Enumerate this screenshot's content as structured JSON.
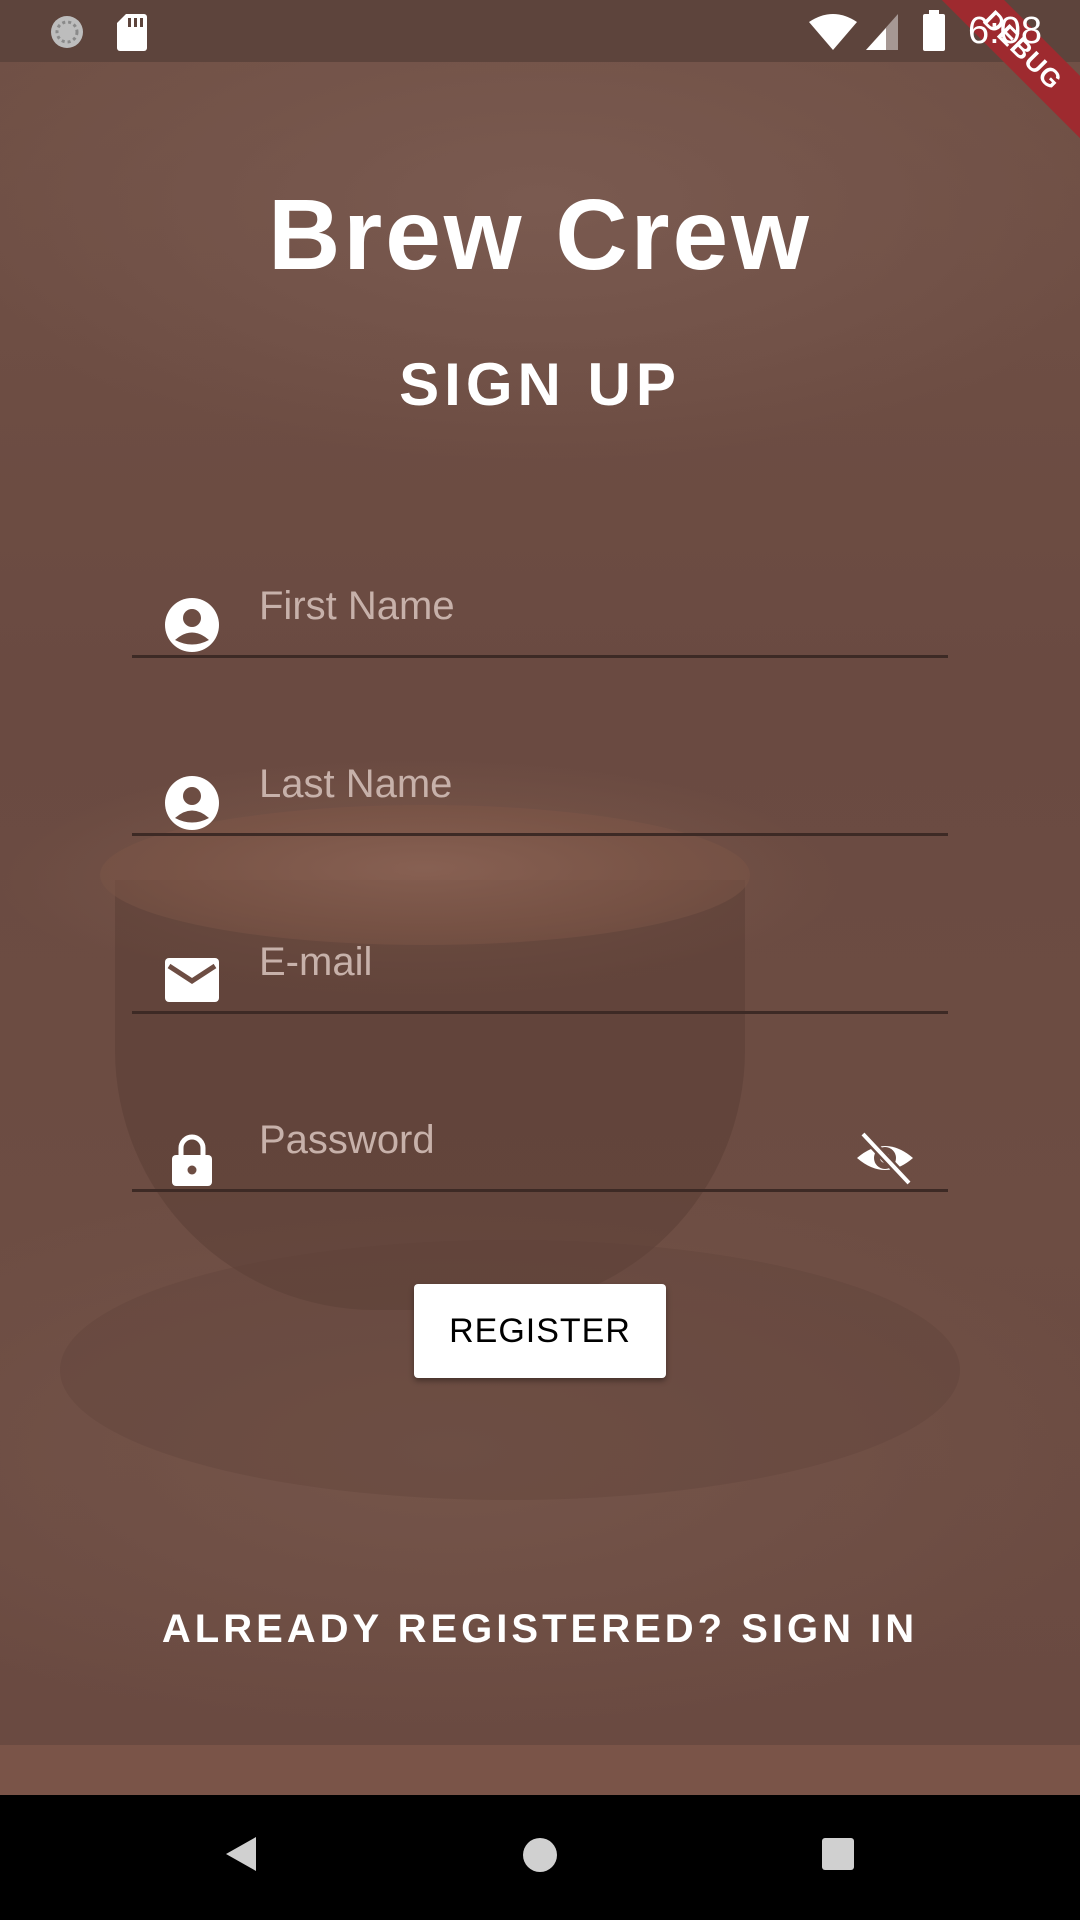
{
  "status_bar": {
    "time": "6:08",
    "debug_label": "DEBUG",
    "icons": [
      "sync-circle-icon",
      "sd-card-icon",
      "wifi-icon",
      "cellular-signal-icon",
      "battery-icon"
    ]
  },
  "app": {
    "title": "Brew Crew",
    "subtitle": "SIGN UP"
  },
  "form": {
    "first_name": {
      "placeholder": "First Name",
      "value": "",
      "icon": "account-circle-icon"
    },
    "last_name": {
      "placeholder": "Last Name",
      "value": "",
      "icon": "account-circle-icon"
    },
    "email": {
      "placeholder": "E-mail",
      "value": "",
      "icon": "mail-icon"
    },
    "password": {
      "placeholder": "Password",
      "value": "",
      "icon": "lock-icon",
      "toggle_icon": "visibility-off-icon"
    },
    "register_label": "REGISTER"
  },
  "sign_in_link": "ALREADY REGISTERED? SIGN IN",
  "nav_bar": {
    "icons": [
      "back-triangle-icon",
      "home-circle-icon",
      "recents-square-icon"
    ]
  },
  "colors": {
    "background": "#6d4d43",
    "status_bar": "#5d443c",
    "field_underline": "#3d2a25",
    "placeholder": "#c7b1aa",
    "debug_banner": "#9e2a2f"
  }
}
